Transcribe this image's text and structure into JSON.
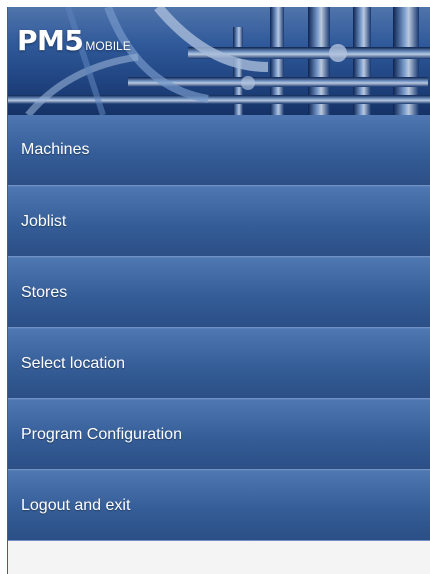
{
  "header": {
    "logo_main": "PM5",
    "logo_sub": "MOBILE"
  },
  "menu": {
    "items": [
      {
        "label": "Machines"
      },
      {
        "label": "Joblist"
      },
      {
        "label": "Stores"
      },
      {
        "label": "Select location"
      },
      {
        "label": "Program Configuration"
      },
      {
        "label": "Logout and exit"
      }
    ]
  },
  "colors": {
    "menu_bg": "#3a629c",
    "menu_text": "#ffffff",
    "page_bg": "#f4f4f4"
  }
}
